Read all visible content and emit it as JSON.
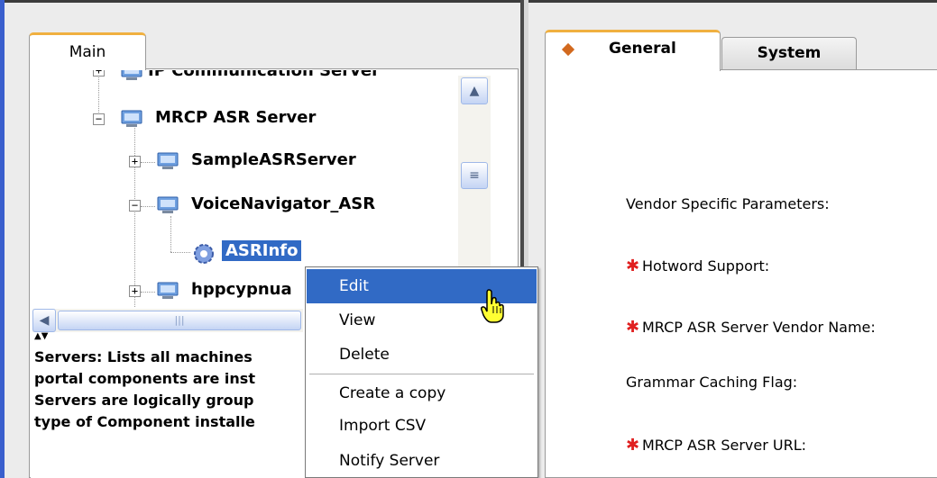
{
  "left_panel": {
    "tab_label": "Main",
    "tree": {
      "nodes": [
        {
          "label": "IP Communication Server",
          "expander": "+",
          "selected": false
        },
        {
          "label": "MRCP ASR Server",
          "expander": "−",
          "selected": false
        },
        {
          "label": "SampleASRServer",
          "expander": "+",
          "selected": false
        },
        {
          "label": "VoiceNavigator_ASR",
          "expander": "−",
          "selected": false
        },
        {
          "label": "ASRInfo",
          "expander": "",
          "selected": true
        },
        {
          "label": "hppcypnua",
          "expander": "+",
          "selected": false
        }
      ],
      "scroll_up_glyph": "▲",
      "scroll_thumb_glyph": "≡",
      "scroll_left_glyph": "◀",
      "scroll_thumb_grip": "|||"
    },
    "splitter_glyph": "▲▼",
    "description_lines": [
      "Servers: Lists all machines",
      "portal components are inst",
      "Servers are logically group",
      "type of Component installe"
    ]
  },
  "context_menu": {
    "items": [
      {
        "label": "Edit",
        "highlighted": true
      },
      {
        "label": "View",
        "highlighted": false
      },
      {
        "label": "Delete",
        "highlighted": false
      },
      {
        "label": "Create a copy",
        "highlighted": false
      },
      {
        "label": "Import CSV",
        "highlighted": false
      },
      {
        "label": "Notify Server",
        "highlighted": false
      }
    ]
  },
  "right_panel": {
    "tabs": [
      {
        "label": "General",
        "active": true
      },
      {
        "label": "System",
        "active": false
      }
    ],
    "fields": [
      {
        "label": "Vendor Specific Parameters:",
        "required": false
      },
      {
        "label": "Hotword Support:",
        "required": true
      },
      {
        "label": "MRCP ASR Server Vendor Name:",
        "required": true
      },
      {
        "label": "Grammar Caching Flag:",
        "required": false
      },
      {
        "label": "MRCP ASR Server URL:",
        "required": true
      }
    ],
    "required_marker": "✱"
  },
  "colors": {
    "selection": "#316ac5",
    "tab_accent": "#f0b040",
    "required": "#e02020",
    "diamond": "#d2691e"
  }
}
